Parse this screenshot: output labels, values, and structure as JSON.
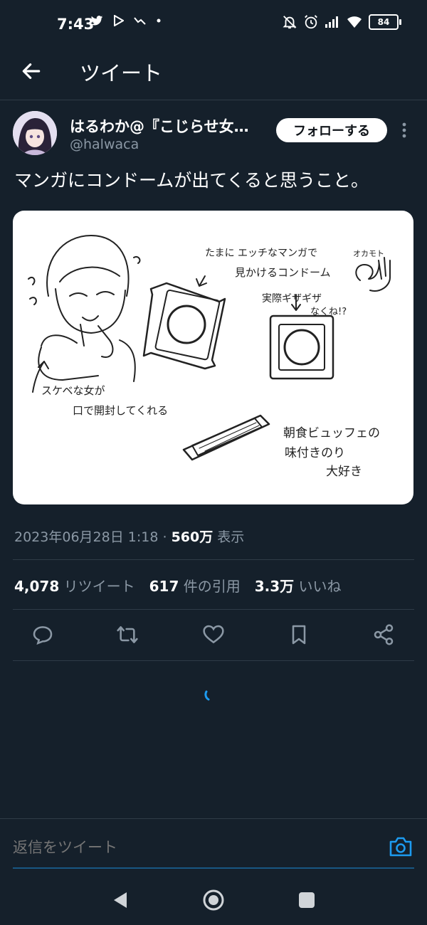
{
  "status_bar": {
    "time": "7:43",
    "battery": "84",
    "left_icons": [
      "twitter-icon",
      "play-store-icon",
      "trend-icon",
      "dot-icon"
    ],
    "right_icons": [
      "mute-icon",
      "alarm-icon",
      "signal-icon",
      "wifi-icon",
      "battery-icon"
    ]
  },
  "header": {
    "title": "ツイート"
  },
  "tweet": {
    "author_name": "はるわか@『こじらせ女…",
    "author_handle": "@halwaca",
    "follow_label": "フォローする",
    "text": "マンガにコンドームが出てくると思うこと。",
    "media_text": {
      "top_caption_1": "たまに エッチなマンガで",
      "top_caption_2": "見かけるコンドーム",
      "ok_sign": "オカモト",
      "real_1": "実際ギザギザ",
      "real_2": "なくね!?",
      "girl_1": "スケベな女が",
      "girl_2": "口で開封してくれる",
      "nori_1": "朝食ビュッフェの",
      "nori_2": "味付きのり",
      "nori_3": "大好き"
    },
    "timestamp": "2023年06月28日 1:18",
    "views_count": "560万",
    "views_label": "表示",
    "separator": "·"
  },
  "stats": {
    "retweets_count": "4,078",
    "retweets_label": "リツイート",
    "quotes_count": "617",
    "quotes_label": "件の引用",
    "likes_count": "3.3万",
    "likes_label": "いいね"
  },
  "reply": {
    "placeholder": "返信をツイート"
  },
  "colors": {
    "background": "#15202b",
    "accent": "#1d9bf0",
    "text": "#e7e9ea",
    "muted": "#8b98a5"
  }
}
